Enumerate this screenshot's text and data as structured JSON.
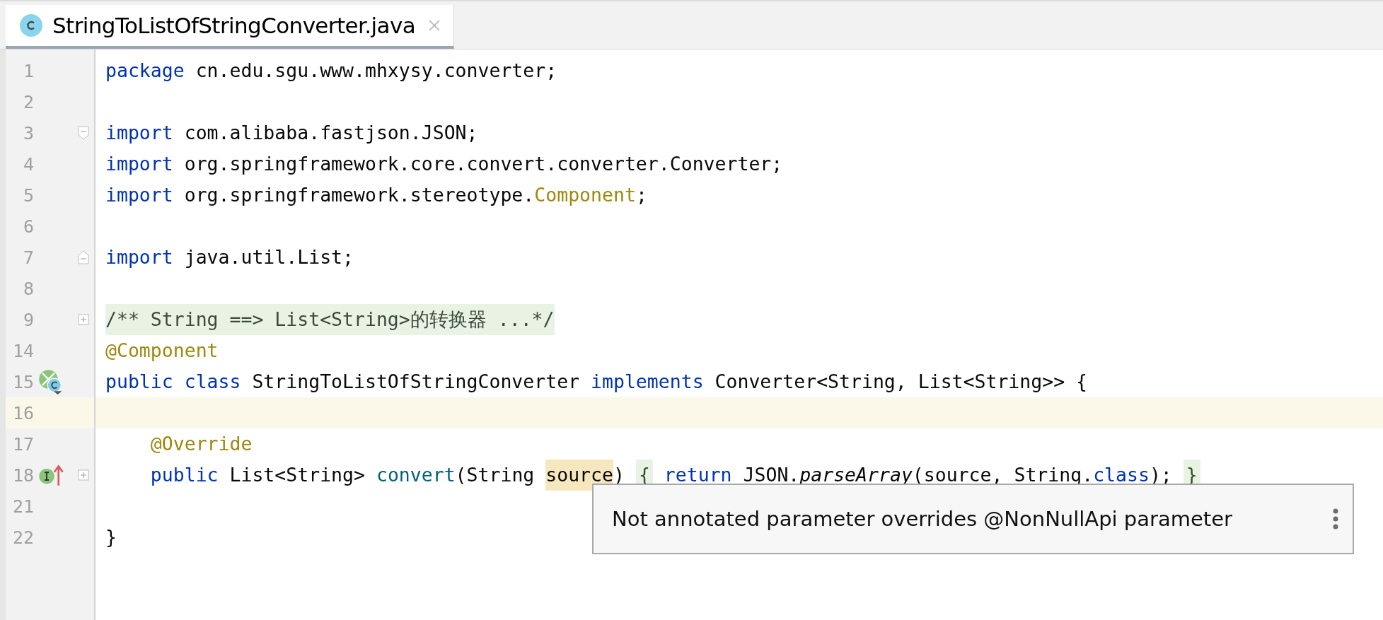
{
  "tabs": [
    {
      "label": "StringToListOfStringConverter.java",
      "selected": true
    }
  ],
  "lines": [
    {
      "number": "1",
      "tokens": [
        {
          "kind": "keyword",
          "text": "package"
        },
        {
          "kind": "plain",
          "text": " cn.edu.sgu.www.mhxysy.converter;"
        }
      ]
    },
    {
      "number": "2"
    },
    {
      "number": "3",
      "fold_marker": {
        "kind": "start"
      },
      "tokens": [
        {
          "kind": "keyword",
          "text": "import"
        },
        {
          "kind": "plain",
          "text": " com.alibaba.fastjson.JSON;"
        }
      ]
    },
    {
      "number": "4",
      "tokens": [
        {
          "kind": "keyword",
          "text": "import"
        },
        {
          "kind": "plain",
          "text": " org.springframework.core.convert.converter.Converter;"
        }
      ]
    },
    {
      "number": "5",
      "tokens": [
        {
          "kind": "keyword",
          "text": "import"
        },
        {
          "kind": "plain",
          "text": " org.springframework.stereotype."
        },
        {
          "kind": "annotation",
          "text": "Component"
        },
        {
          "kind": "plain",
          "text": ";"
        }
      ]
    },
    {
      "number": "6"
    },
    {
      "number": "7",
      "fold_marker": {
        "kind": "end"
      },
      "tokens": [
        {
          "kind": "keyword",
          "text": "import"
        },
        {
          "kind": "plain",
          "text": " java.util.List;"
        }
      ]
    },
    {
      "number": "8"
    },
    {
      "number": "9",
      "fold_marker": {
        "kind": "collapsed"
      },
      "tokens": [
        {
          "kind": "folded-comment",
          "text": "/** String ==> List<String>的转换器 ...*/"
        }
      ]
    },
    {
      "number": "14",
      "tokens": [
        {
          "kind": "annotation",
          "text": "@Component"
        }
      ]
    },
    {
      "number": "15",
      "gutter_icon": {
        "kind": "implemented"
      },
      "tokens": [
        {
          "kind": "keyword",
          "text": "public class"
        },
        {
          "kind": "plain",
          "text": " StringToListOfStringConverter "
        },
        {
          "kind": "keyword",
          "text": "implements"
        },
        {
          "kind": "plain",
          "text": " Converter<String, List<String>> {"
        }
      ]
    },
    {
      "number": "16",
      "current": true
    },
    {
      "number": "17",
      "tokens": [
        {
          "kind": "annotation",
          "text": "    @Override"
        }
      ]
    },
    {
      "number": "18",
      "gutter_icon": {
        "kind": "overrides"
      },
      "fold_marker": {
        "kind": "collapsed"
      },
      "tokens": [
        {
          "kind": "keyword",
          "text": "    public"
        },
        {
          "kind": "plain",
          "text": " List<String> "
        },
        {
          "kind": "method",
          "text": "convert"
        },
        {
          "kind": "plain",
          "text": "(String "
        },
        {
          "kind": "usage",
          "text": "source"
        },
        {
          "kind": "plain",
          "text": ") "
        },
        {
          "kind": "folded",
          "text": "{"
        },
        {
          "kind": "keyword",
          "text": " return"
        },
        {
          "kind": "plain",
          "text": " JSON."
        },
        {
          "kind": "static",
          "text": "parseArray"
        },
        {
          "kind": "plain",
          "text": "(source, String."
        },
        {
          "kind": "keyword",
          "text": "class"
        },
        {
          "kind": "plain",
          "text": "); "
        },
        {
          "kind": "folded",
          "text": "}"
        }
      ]
    },
    {
      "number": "21"
    },
    {
      "number": "22",
      "tokens": [
        {
          "kind": "plain",
          "text": "}"
        }
      ]
    }
  ],
  "tooltip": {
    "text": "Not annotated parameter overrides @NonNullApi parameter"
  }
}
